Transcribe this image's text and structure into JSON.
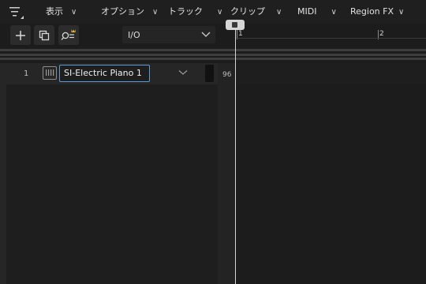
{
  "menubar": {
    "items": [
      {
        "label": "表示"
      },
      {
        "label": "オプション"
      },
      {
        "label": "トラック"
      },
      {
        "label": "クリップ"
      },
      {
        "label": "MIDI"
      },
      {
        "label": "Region FX"
      }
    ]
  },
  "toolbar": {
    "io_select": {
      "value": "I/O"
    }
  },
  "ruler": {
    "marks": [
      "1",
      "2"
    ]
  },
  "tracks": [
    {
      "number": "1",
      "name": "SI-Electric Piano 1",
      "volume": "96"
    }
  ],
  "colors": {
    "accent": "#5b9bd5",
    "background": "#1c1c1c",
    "playhead": "#d6d6d6"
  }
}
